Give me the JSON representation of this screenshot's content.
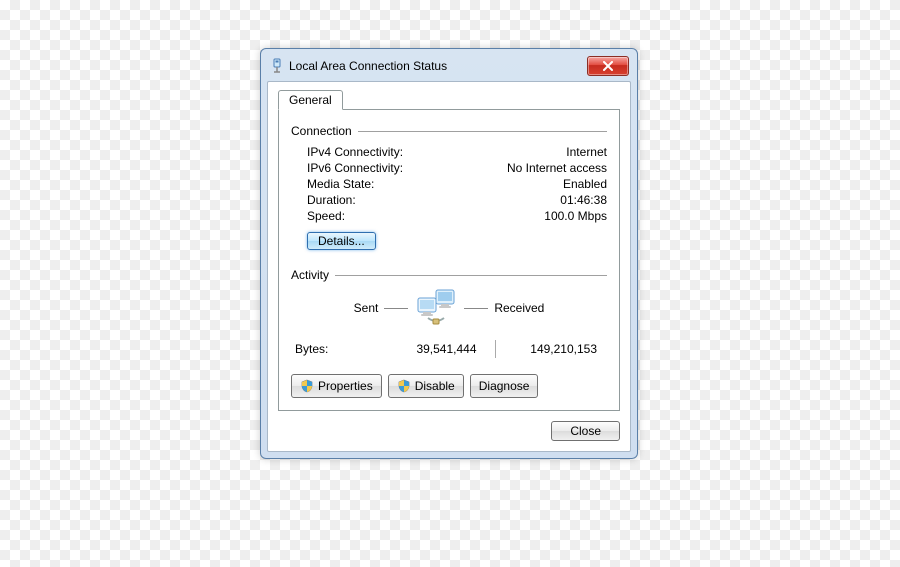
{
  "window": {
    "title": "Local Area Connection Status"
  },
  "tabs": {
    "general": "General"
  },
  "connection": {
    "group_label": "Connection",
    "ipv4_label": "IPv4 Connectivity:",
    "ipv4_value": "Internet",
    "ipv6_label": "IPv6 Connectivity:",
    "ipv6_value": "No Internet access",
    "media_label": "Media State:",
    "media_value": "Enabled",
    "duration_label": "Duration:",
    "duration_value": "01:46:38",
    "speed_label": "Speed:",
    "speed_value": "100.0 Mbps",
    "details_button": "Details..."
  },
  "activity": {
    "group_label": "Activity",
    "sent_label": "Sent",
    "received_label": "Received",
    "bytes_label": "Bytes:",
    "bytes_sent": "39,541,444",
    "bytes_received": "149,210,153"
  },
  "buttons": {
    "properties": "Properties",
    "disable": "Disable",
    "diagnose": "Diagnose",
    "close": "Close"
  }
}
